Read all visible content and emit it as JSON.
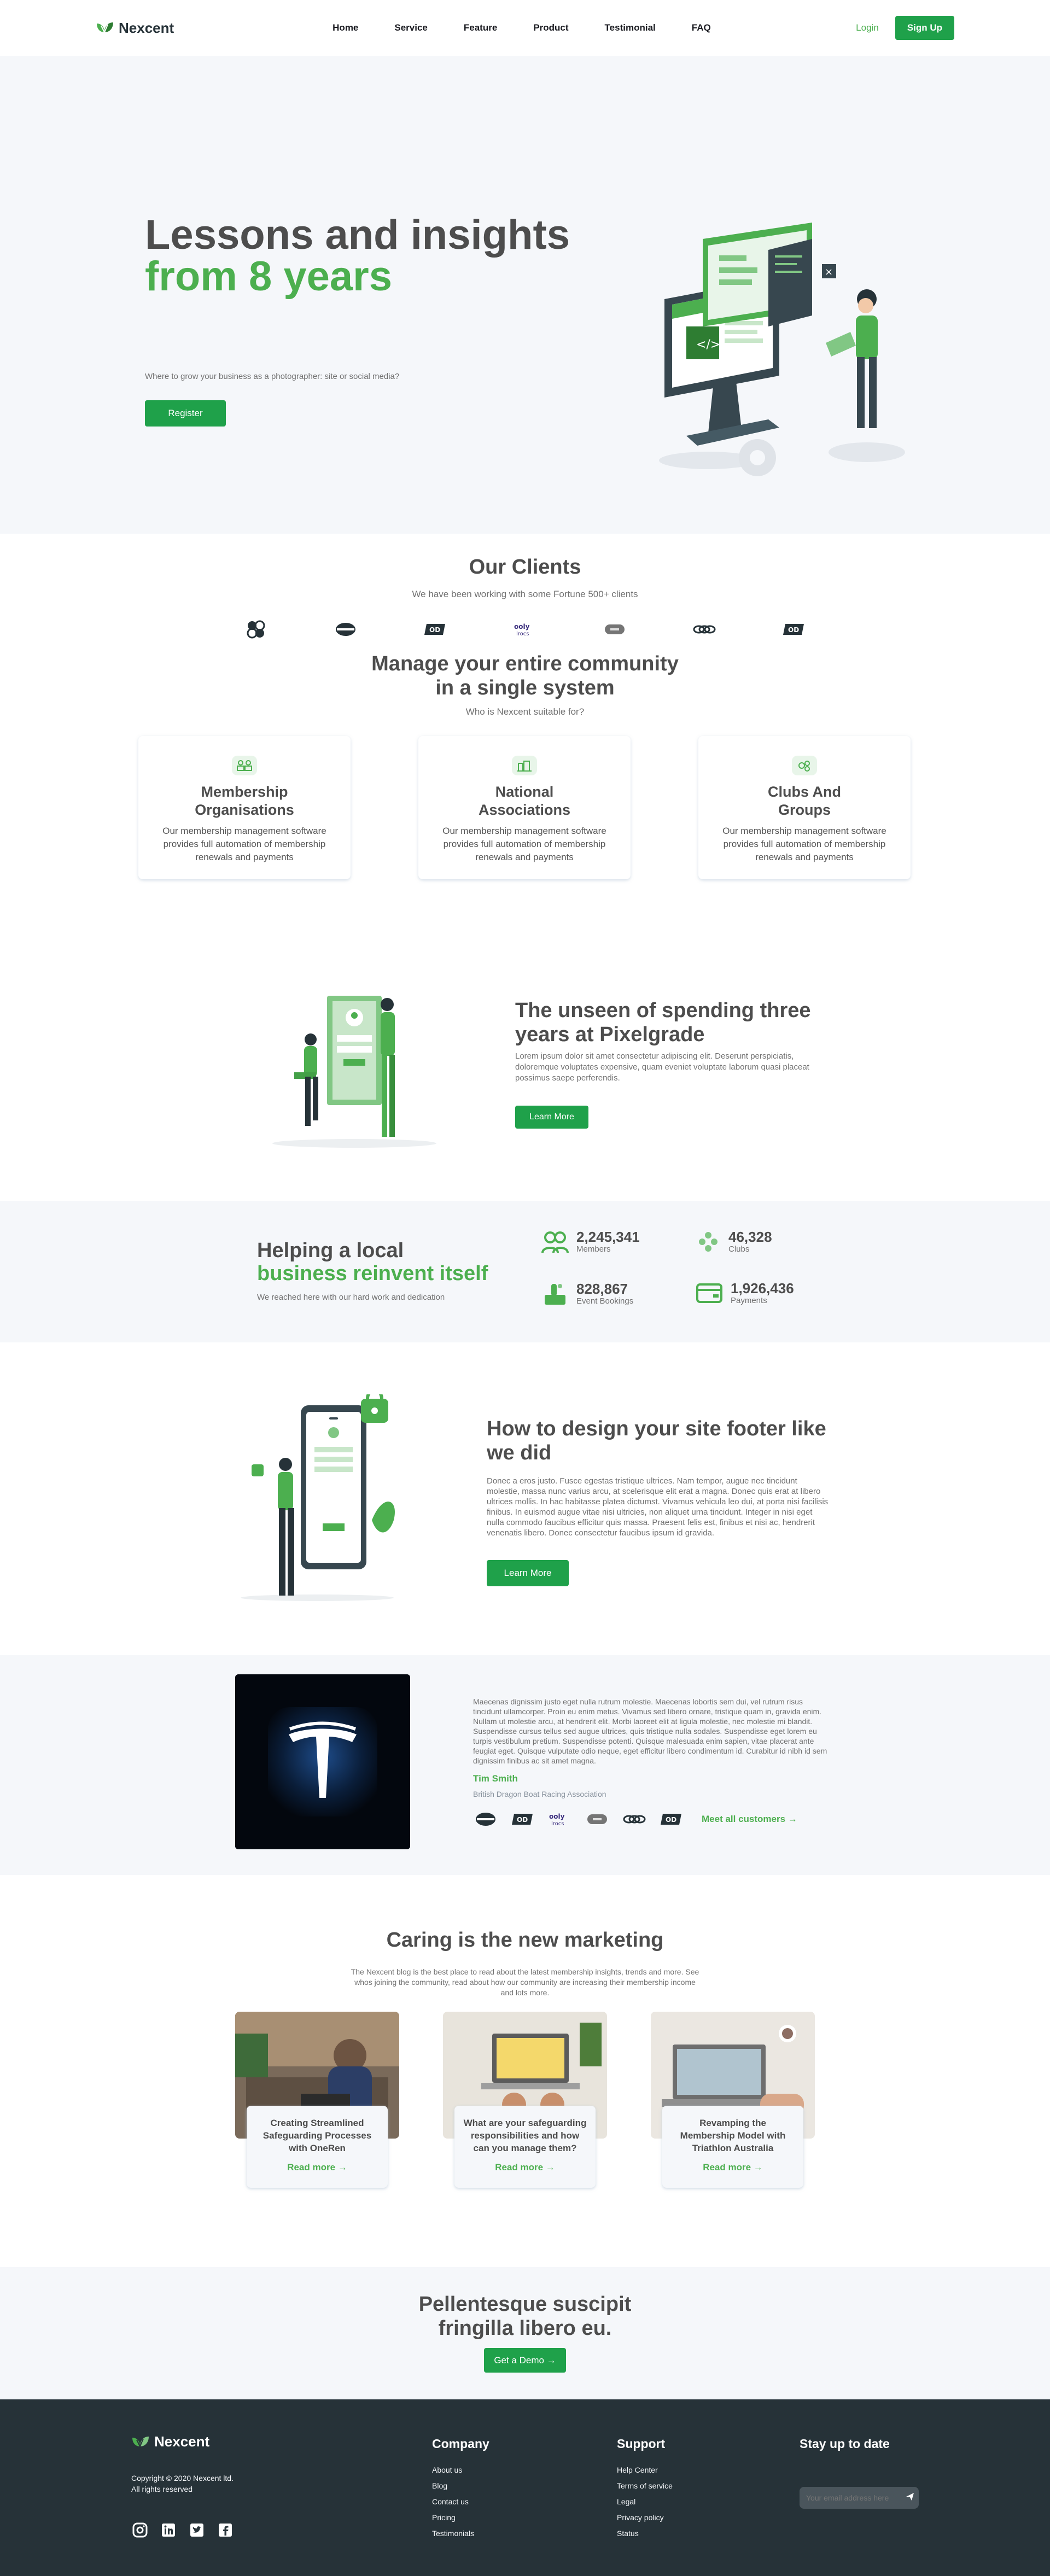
{
  "brand": {
    "name": "Nexcent",
    "accent": "#4CAF4F",
    "button": "#1fa14a",
    "dark": "#263238"
  },
  "nav": {
    "links": [
      "Home",
      "Service",
      "Feature",
      "Product",
      "Testimonial",
      "FAQ"
    ],
    "login": "Login",
    "signup": "Sign Up"
  },
  "hero": {
    "title_line1": "Lessons and insights",
    "title_line2": "from 8 years",
    "subtitle": "Where to grow your business as a photographer: site or social media?",
    "cta": "Register"
  },
  "clients": {
    "title": "Our Clients",
    "subtitle": "We have been working with some Fortune 500+ clients",
    "logos": [
      "client-logo-1",
      "client-logo-2",
      "client-logo-3",
      "client-logo-4",
      "client-logo-5",
      "client-logo-6",
      "client-logo-7"
    ]
  },
  "community": {
    "title_line1": "Manage your entire community",
    "title_line2": "in a single system",
    "subtitle": "Who is Nexcent suitable for?",
    "cards": [
      {
        "title_line1": "Membership",
        "title_line2": "Organisations",
        "text": "Our membership management software provides full automation of membership renewals and payments",
        "icon": "membership-icon"
      },
      {
        "title_line1": "National",
        "title_line2": "Associations",
        "text": "Our membership management software provides full automation of membership renewals and payments",
        "icon": "associations-icon"
      },
      {
        "title_line1": "Clubs And",
        "title_line2": "Groups",
        "text": "Our membership management software provides full automation of membership renewals and payments",
        "icon": "clubs-icon"
      }
    ]
  },
  "unseen": {
    "title": "The unseen of spending three years at Pixelgrade",
    "text": "Lorem ipsum dolor sit amet consectetur adipiscing elit. Deserunt perspiciatis, doloremque voluptates expensive, quam eveniet voluptate laborum quasi placeat possimus saepe perferendis.",
    "cta": "Learn More"
  },
  "stats": {
    "title_line1": "Helping a local",
    "title_line2": "business reinvent itself",
    "subtitle": "We reached here with our hard work and dedication",
    "items": [
      {
        "value": "2,245,341",
        "label": "Members",
        "icon": "members-icon"
      },
      {
        "value": "46,328",
        "label": "Clubs",
        "icon": "clubs-hand-icon"
      },
      {
        "value": "828,867",
        "label": "Event Bookings",
        "icon": "event-icon"
      },
      {
        "value": "1,926,436",
        "label": "Payments",
        "icon": "payment-icon"
      }
    ]
  },
  "design": {
    "title": "How to design your site footer like we did",
    "text": "Donec a eros justo. Fusce egestas tristique ultrices. Nam tempor, augue nec tincidunt molestie, massa nunc varius arcu, at scelerisque elit erat a magna. Donec quis erat at libero ultrices mollis. In hac habitasse platea dictumst. Vivamus vehicula leo dui, at porta nisi facilisis finibus. In euismod augue vitae nisi ultricies, non aliquet urna tincidunt. Integer in nisi eget nulla commodo faucibus efficitur quis massa. Praesent felis est, finibus et nisi ac, hendrerit venenatis libero. Donec consectetur faucibus ipsum id gravida.",
    "cta": "Learn More"
  },
  "testimonial": {
    "text": "Maecenas dignissim justo eget nulla rutrum molestie. Maecenas lobortis sem dui, vel rutrum risus tincidunt ullamcorper. Proin eu enim metus. Vivamus sed libero ornare, tristique quam in, gravida enim. Nullam ut molestie arcu, at hendrerit elit. Morbi laoreet elit at ligula molestie, nec molestie mi blandit. Suspendisse cursus tellus sed augue ultrices, quis tristique nulla sodales. Suspendisse eget lorem eu turpis vestibulum pretium. Suspendisse potenti. Quisque malesuada enim sapien, vitae placerat ante feugiat eget. Quisque vulputate odio neque, eget efficitur libero condimentum id. Curabitur id nibh id sem dignissim finibus ac sit amet magna.",
    "name": "Tim Smith",
    "role": "British Dragon Boat Racing Association",
    "meet": "Meet all customers →"
  },
  "blog": {
    "title": "Caring is the new marketing",
    "subtitle": "The Nexcent blog is the best place to read about the latest membership insights, trends and more. See whos joining the community, read about how our community are increasing their membership income and lots more.",
    "posts": [
      {
        "title": "Creating Streamlined Safeguarding Processes with OneRen",
        "read": "Read more →"
      },
      {
        "title": "What are your safeguarding responsibilities and how can you manage them?",
        "read": "Read more →"
      },
      {
        "title": "Revamping the Membership Model with Triathlon Australia",
        "read": "Read more →"
      }
    ]
  },
  "cta": {
    "title_line1": "Pellentesque suscipit",
    "title_line2": "fringilla libero eu.",
    "button": "Get a Demo →"
  },
  "footer": {
    "copy_line1": "Copyright © 2020 Nexcent ltd.",
    "copy_line2": "All rights reserved",
    "company_title": "Company",
    "company_links": [
      "About us",
      "Blog",
      "Contact us",
      "Pricing",
      "Testimonials"
    ],
    "support_title": "Support",
    "support_links": [
      "Help Center",
      "Terms of service",
      "Legal",
      "Privacy policy",
      "Status"
    ],
    "newsletter_title": "Stay up to date",
    "email_placeholder": "Your email address here",
    "social": [
      "instagram-icon",
      "linkedin-icon",
      "twitter-icon",
      "facebook-icon"
    ]
  }
}
